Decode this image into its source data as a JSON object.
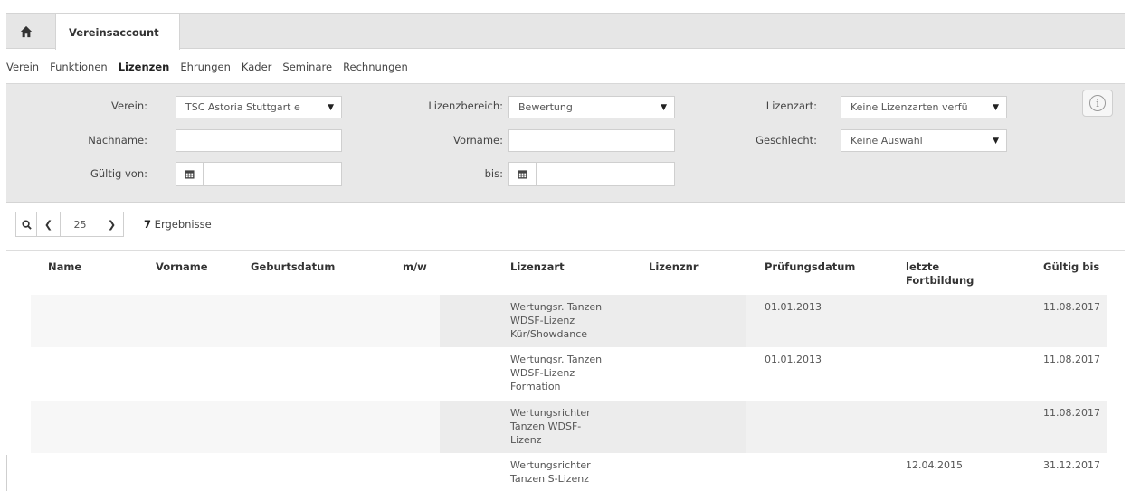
{
  "header": {
    "tab_label": "Vereinsaccount"
  },
  "subnav": [
    {
      "label": "Verein",
      "active": false
    },
    {
      "label": "Funktionen",
      "active": false
    },
    {
      "label": "Lizenzen",
      "active": true
    },
    {
      "label": "Ehrungen",
      "active": false
    },
    {
      "label": "Kader",
      "active": false
    },
    {
      "label": "Seminare",
      "active": false
    },
    {
      "label": "Rechnungen",
      "active": false
    }
  ],
  "filters": {
    "verein_label": "Verein:",
    "verein_value": "TSC Astoria Stuttgart e",
    "lizenzbereich_label": "Lizenzbereich:",
    "lizenzbereich_value": "Bewertung",
    "lizenzart_label": "Lizenzart:",
    "lizenzart_value": "Keine Lizenzarten verfü",
    "nachname_label": "Nachname:",
    "nachname_value": "",
    "vorname_label": "Vorname:",
    "vorname_value": "",
    "geschlecht_label": "Geschlecht:",
    "geschlecht_value": "Keine Auswahl",
    "gueltig_von_label": "Gültig von:",
    "gueltig_von_value": "",
    "bis_label": "bis:",
    "bis_value": ""
  },
  "pager": {
    "page_size": "25",
    "result_count": "7",
    "result_label": "Ergebnisse"
  },
  "table": {
    "columns": [
      "Name",
      "Vorname",
      "Geburtsdatum",
      "m/w",
      "Lizenzart",
      "Lizenznr",
      "Prüfungsdatum",
      "letzte Fortbildung",
      "Gültig bis"
    ],
    "rows": [
      {
        "lizenzart": [
          "Wertungsr. Tanzen",
          "WDSF-Lizenz",
          "Kür/Showdance"
        ],
        "pruefungsdatum": "01.01.2013",
        "fortbildung": "",
        "gueltig_bis": "11.08.2017"
      },
      {
        "lizenzart": [
          "Wertungsr. Tanzen",
          "WDSF-Lizenz",
          "Formation"
        ],
        "pruefungsdatum": "01.01.2013",
        "fortbildung": "",
        "gueltig_bis": "11.08.2017"
      },
      {
        "lizenzart": [
          "Wertungsrichter",
          "Tanzen WDSF-",
          "Lizenz"
        ],
        "pruefungsdatum": "",
        "fortbildung": "",
        "gueltig_bis": "11.08.2017"
      },
      {
        "lizenzart": [
          "Wertungsrichter",
          "Tanzen S-Lizenz"
        ],
        "pruefungsdatum": "",
        "fortbildung": "12.04.2015",
        "gueltig_bis": "31.12.2017"
      }
    ]
  },
  "colors": {
    "tabbar_bg": "#e6e6e6",
    "filter_bg": "#e8e8e8",
    "cell_shade": "#ececec"
  },
  "icons": {
    "home": "home-icon",
    "calendar": "calendar-icon",
    "search": "search-icon",
    "info": "info-icon"
  }
}
